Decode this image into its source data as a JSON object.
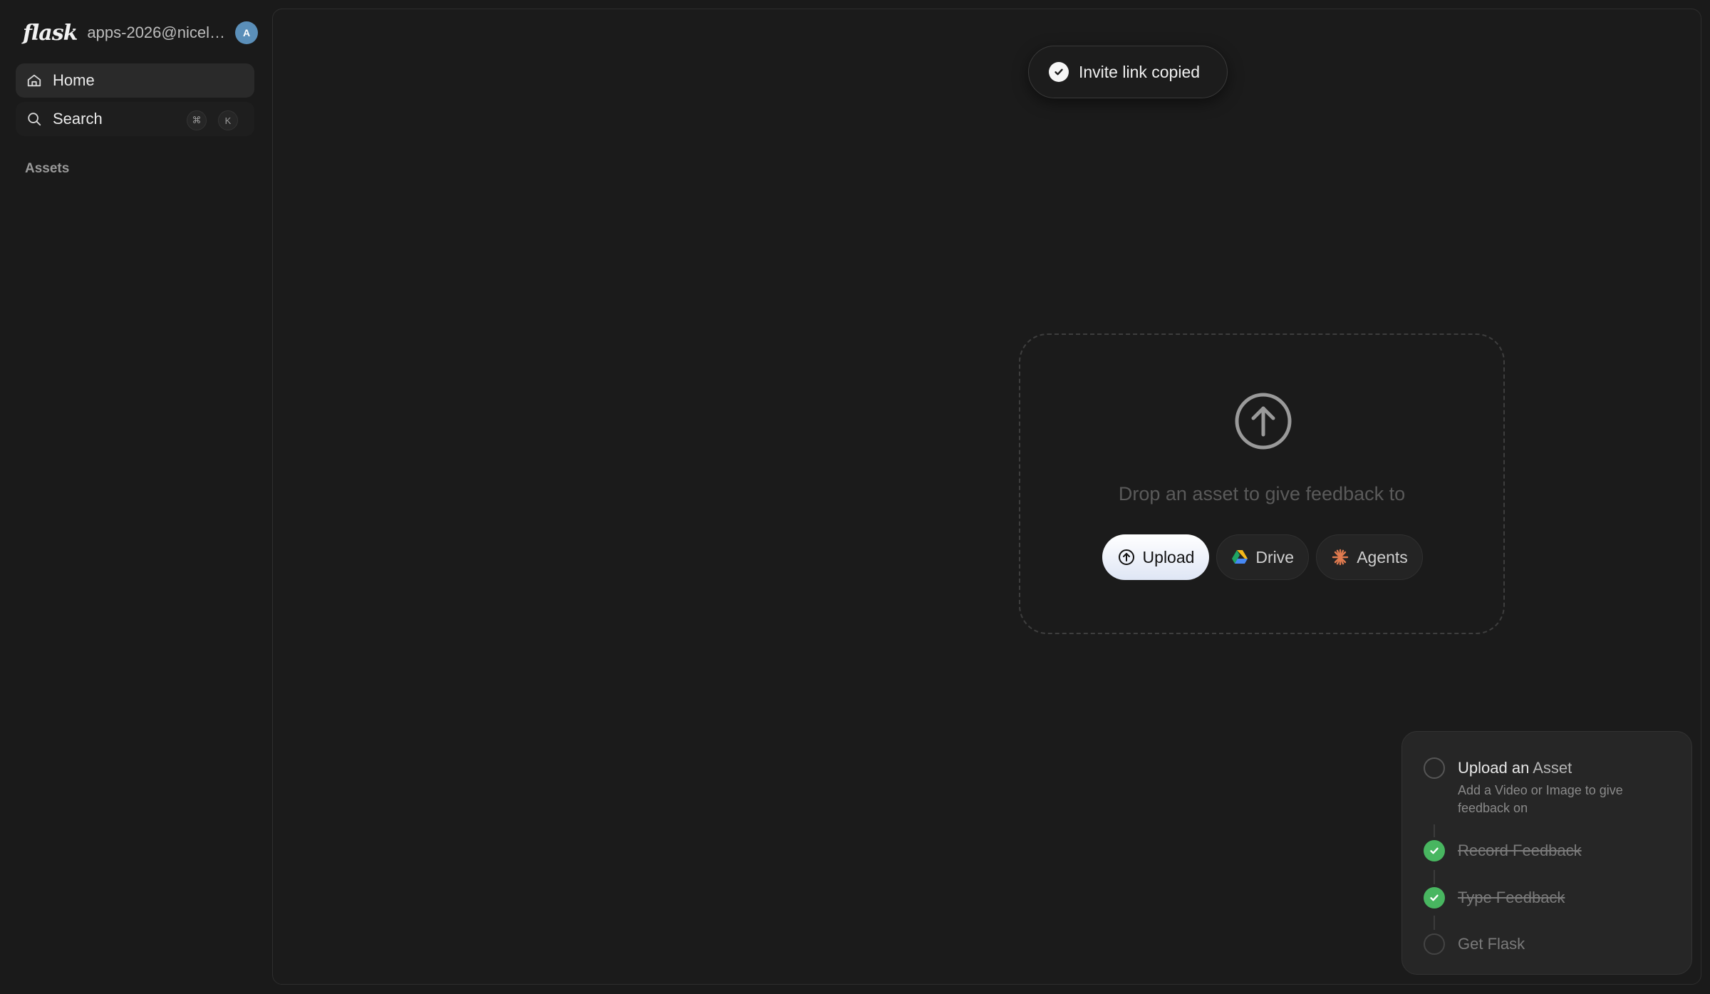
{
  "sidebar": {
    "logo": "flask",
    "account": "apps-2026@nicely...",
    "avatar_initial": "A",
    "avatar_color": "#5b8fb9",
    "nav": [
      {
        "label": "Home",
        "icon": "home-icon"
      },
      {
        "label": "Search",
        "icon": "search-icon"
      }
    ],
    "shortcut": [
      "⌘",
      "K"
    ],
    "section_label": "Assets"
  },
  "toast": {
    "text": "Invite link copied",
    "icon": "check-circle-icon"
  },
  "dropzone": {
    "icon": "upload-arrow-icon",
    "text": "Drop an asset to give feedback to",
    "buttons": [
      {
        "label": "Upload",
        "icon": "upload-icon"
      },
      {
        "label": "Drive",
        "icon": "google-drive-icon"
      },
      {
        "label": "Agents",
        "icon": "agents-starburst-icon"
      }
    ]
  },
  "checklist": {
    "steps": [
      {
        "title_a": "Upload an",
        "title_b": "Asset",
        "desc": "Add a Video or Image to give feedback on",
        "done": false
      },
      {
        "title": "Record Feedback",
        "done": true
      },
      {
        "title": "Type Feedback",
        "done": true
      },
      {
        "title": "Get Flask",
        "done": false
      }
    ],
    "done_color": "#48b660"
  }
}
